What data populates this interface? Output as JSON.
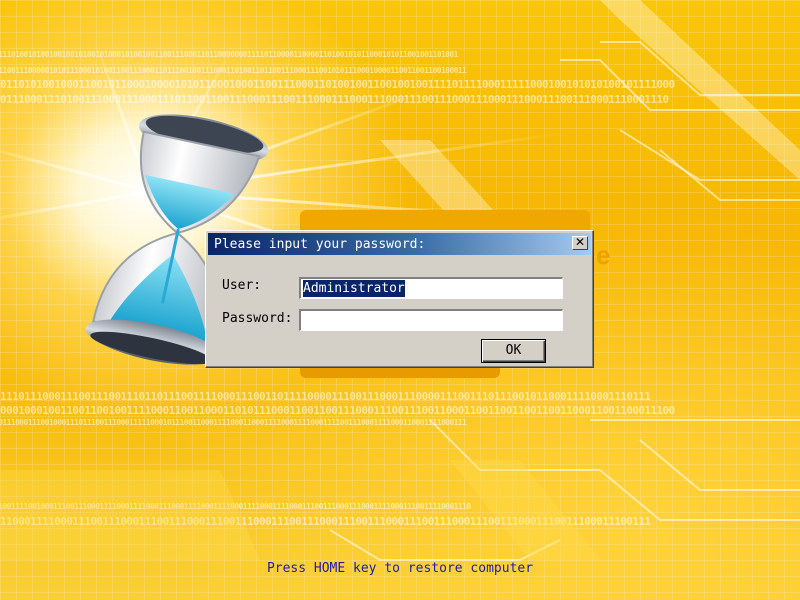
{
  "background": {
    "accent": "#f6b600",
    "binary_rows": [
      "01110100101001001001010010100010100100110011100011011000000011110110000110000110100101011000101011001001101001",
      "1110011100000101011100010100110011100011011100100111000110100110110011100011100101011100010000110011001100100011",
      "10110101001000110010110001000010101100010001100111000110100100110010010011110111100011111000100101010100101111000",
      "0011100011101001110001110001110110011001110001110011100011100011100011100111000111000111000111001110001110001110",
      "0111011100011100111001110110111001111000111001101111000011100111000111000011100111011100101100011110001110111",
      "10001000100110011001001111000110011000110101110001100110011100011100111001100011001100110011001100011001100011100",
      "0011100011100100011101110011100011111000101110011000111100011000111100011110001111001110001111000110001111000111",
      "11001111001000111001110001111000111100011100011110001111000111100011110001110011100011100011110001110011110001110",
      "1110001111000111001110001110011100011100111000111001110001110011100011100111000111001110001110011100011100111"
    ]
  },
  "hourglass": {
    "icon": "hourglass-icon"
  },
  "dialog": {
    "title": "Please input your password:",
    "close_icon": "close-icon",
    "user_label": "User:",
    "user_value": "Administrator",
    "password_label": "Password:",
    "password_value": "",
    "ok_label": "OK"
  },
  "behind": {
    "partial_e": "e"
  },
  "hint": "Press HOME key to restore computer"
}
